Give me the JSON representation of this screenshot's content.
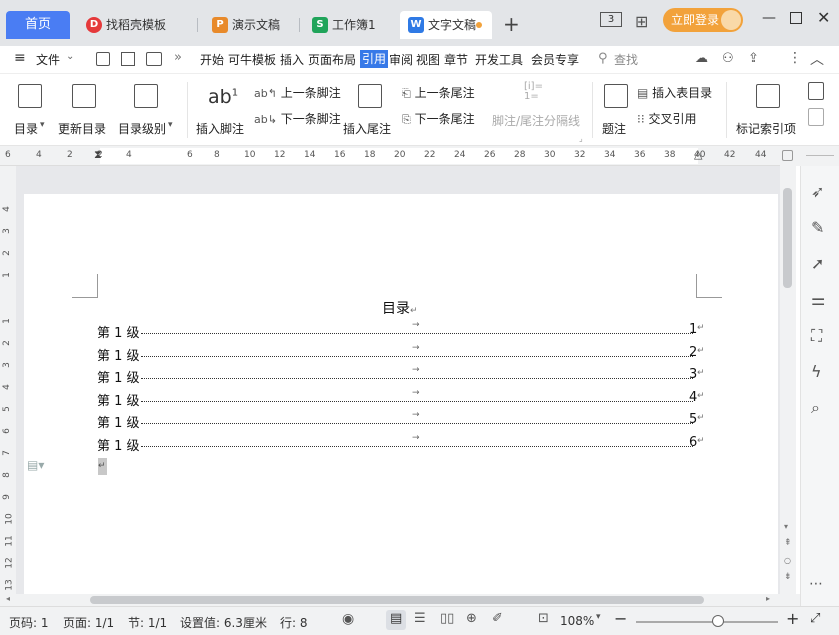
{
  "tabs": {
    "home": "首页",
    "items": [
      {
        "label": "找稻壳模板",
        "icon_text": "D",
        "color": "#e5393b"
      },
      {
        "label": "演示文稿",
        "icon_text": "P",
        "color": "#e88a2b"
      },
      {
        "label": "工作簿1",
        "icon_text": "S",
        "color": "#20a45a"
      },
      {
        "label": "文字文稿",
        "icon_text": "W",
        "color": "#2f7ae5"
      }
    ],
    "new_tab": "+",
    "box_label": "3"
  },
  "account": {
    "login_label": "立即登录"
  },
  "menu": {
    "file": "文件",
    "items": [
      "开始",
      "可牛模板",
      "插入",
      "页面布局",
      "引用",
      "审阅",
      "视图",
      "章节",
      "开发工具",
      "会员专享"
    ],
    "active": "引用",
    "search": "查找"
  },
  "ribbon": {
    "toc": "目录",
    "update_toc": "更新目录",
    "toc_level": "目录级别",
    "insert_footnote": "插入脚注",
    "prev_footnote": "上一条脚注",
    "next_footnote": "下一条脚注",
    "insert_endnote": "插入尾注",
    "prev_endnote": "上一条尾注",
    "next_endnote": "下一条尾注",
    "separator_line": "脚注/尾注分隔线",
    "caption": "题注",
    "insert_table_toc": "插入表目录",
    "cross_ref": "交叉引用",
    "mark_index": "标记索引项",
    "ab_glyph": "ab",
    "ab_sup": "1"
  },
  "ruler": {
    "marks": [
      "6",
      "4",
      "2",
      "2",
      "4",
      "6",
      "8",
      "10",
      "12",
      "14",
      "16",
      "18",
      "20",
      "22",
      "24",
      "26",
      "28",
      "30",
      "32",
      "34",
      "36",
      "38",
      "40",
      "42",
      "44"
    ],
    "vmarks": [
      "4",
      "3",
      "2",
      "1",
      "1",
      "2",
      "3",
      "4",
      "5",
      "6",
      "7",
      "8",
      "9",
      "10",
      "11",
      "12",
      "13"
    ]
  },
  "document": {
    "title": "目录",
    "entries": [
      {
        "text": "第 1 级",
        "page": "1"
      },
      {
        "text": "第 1 级",
        "page": "2"
      },
      {
        "text": "第 1 级",
        "page": "3"
      },
      {
        "text": "第 1 级",
        "page": "4"
      },
      {
        "text": "第 1 级",
        "page": "5"
      },
      {
        "text": "第 1 级",
        "page": "6"
      }
    ]
  },
  "status": {
    "page_code": "页码: 1",
    "page": "页面: 1/1",
    "section": "节: 1/1",
    "setting": "设置值: 6.3厘米",
    "line": "行: 8",
    "zoom": "108%",
    "zoom_level": 0.58
  }
}
